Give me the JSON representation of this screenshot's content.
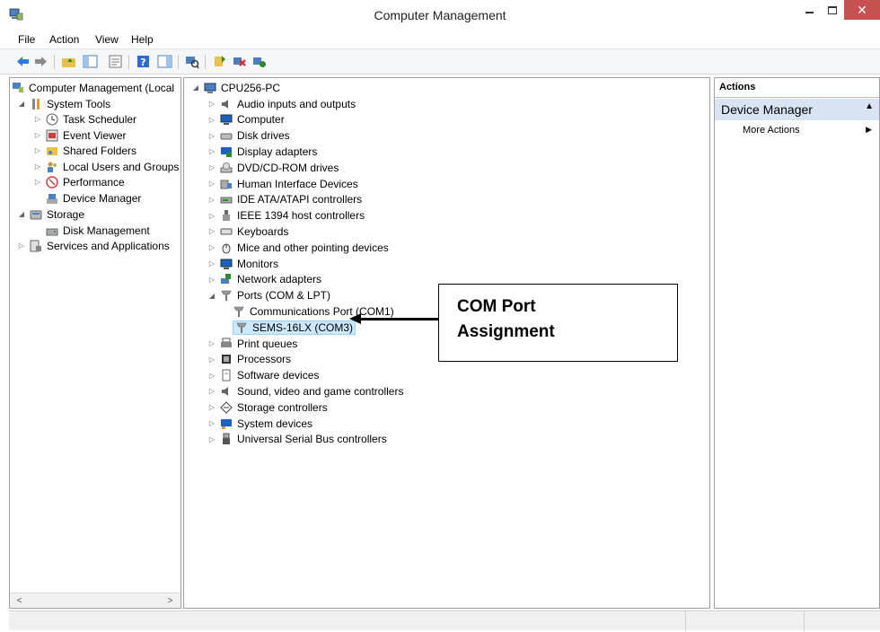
{
  "window": {
    "title": "Computer Management",
    "close_glyph": "✕"
  },
  "menu": [
    "File",
    "Action",
    "View",
    "Help"
  ],
  "toolbar_icons": [
    "back-icon",
    "forward-icon",
    "up-folder-icon",
    "show-hide-tree-icon",
    "properties-icon",
    "help-icon",
    "show-hide-action-icon",
    "scan-hardware-icon",
    "update-driver-icon",
    "uninstall-icon",
    "enable-device-icon"
  ],
  "left_tree": [
    {
      "label": "Computer Management (Local",
      "twisty": "",
      "icon": "computer-management-icon"
    },
    {
      "label": "System Tools",
      "twisty": "◢",
      "icon": "tools-icon"
    },
    {
      "label": "Task Scheduler",
      "twisty": "▷",
      "icon": "clock-icon"
    },
    {
      "label": "Event Viewer",
      "twisty": "▷",
      "icon": "event-viewer-icon"
    },
    {
      "label": "Shared Folders",
      "twisty": "▷",
      "icon": "shared-folder-icon"
    },
    {
      "label": "Local Users and Groups",
      "twisty": "▷",
      "icon": "users-icon"
    },
    {
      "label": "Performance",
      "twisty": "▷",
      "icon": "performance-icon"
    },
    {
      "label": "Device Manager",
      "twisty": "",
      "icon": "device-manager-icon"
    },
    {
      "label": "Storage",
      "twisty": "◢",
      "icon": "storage-icon"
    },
    {
      "label": "Disk Management",
      "twisty": "",
      "icon": "disk-management-icon"
    },
    {
      "label": "Services and Applications",
      "twisty": "▷",
      "icon": "services-icon"
    }
  ],
  "device_tree": {
    "root": {
      "label": "CPU256-PC",
      "twisty": "◢"
    },
    "items": [
      {
        "label": "Audio inputs and outputs",
        "twisty": "▷",
        "icon": "speaker-icon"
      },
      {
        "label": "Computer",
        "twisty": "▷",
        "icon": "monitor-icon"
      },
      {
        "label": "Disk drives",
        "twisty": "▷",
        "icon": "disk-drive-icon"
      },
      {
        "label": "Display adapters",
        "twisty": "▷",
        "icon": "display-adapter-icon"
      },
      {
        "label": "DVD/CD-ROM drives",
        "twisty": "▷",
        "icon": "dvd-icon"
      },
      {
        "label": "Human Interface Devices",
        "twisty": "▷",
        "icon": "hid-icon"
      },
      {
        "label": "IDE ATA/ATAPI controllers",
        "twisty": "▷",
        "icon": "ide-icon"
      },
      {
        "label": "IEEE 1394 host controllers",
        "twisty": "▷",
        "icon": "ieee1394-icon"
      },
      {
        "label": "Keyboards",
        "twisty": "▷",
        "icon": "keyboard-icon"
      },
      {
        "label": "Mice and other pointing devices",
        "twisty": "▷",
        "icon": "mouse-icon"
      },
      {
        "label": "Monitors",
        "twisty": "▷",
        "icon": "monitor-icon"
      },
      {
        "label": "Network adapters",
        "twisty": "▷",
        "icon": "network-adapter-icon"
      },
      {
        "label": "Ports (COM & LPT)",
        "twisty": "◢",
        "icon": "port-icon"
      },
      {
        "label": "Communications Port (COM1)",
        "twisty": "",
        "icon": "port-icon",
        "child": true
      },
      {
        "label": "SEMS-16LX (COM3)",
        "twisty": "",
        "icon": "port-icon",
        "child": true,
        "selected": true
      },
      {
        "label": "Print queues",
        "twisty": "▷",
        "icon": "printer-icon"
      },
      {
        "label": "Processors",
        "twisty": "▷",
        "icon": "processor-icon"
      },
      {
        "label": "Software devices",
        "twisty": "▷",
        "icon": "software-device-icon"
      },
      {
        "label": "Sound, video and game controllers",
        "twisty": "▷",
        "icon": "speaker-icon"
      },
      {
        "label": "Storage controllers",
        "twisty": "▷",
        "icon": "storage-controller-icon"
      },
      {
        "label": "System devices",
        "twisty": "▷",
        "icon": "system-device-icon"
      },
      {
        "label": "Universal Serial Bus controllers",
        "twisty": "▷",
        "icon": "usb-icon"
      }
    ]
  },
  "actions": {
    "header": "Actions",
    "group": "Device Manager",
    "more": "More Actions"
  },
  "callout": {
    "line1": "COM Port",
    "line2": "Assignment"
  },
  "colors": {
    "selection_bg": "#cce8ff",
    "actions_group_bg": "#d8e4f4",
    "close_button": "#c75050"
  }
}
